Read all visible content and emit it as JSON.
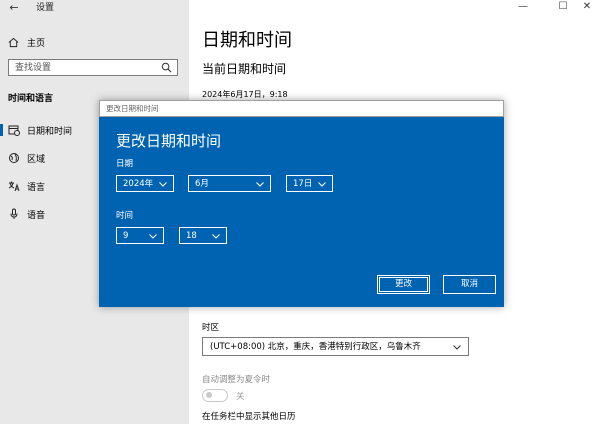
{
  "window": {
    "title": "设置",
    "back_glyph": "←",
    "minimize_glyph": "—",
    "maximize_glyph": "☐",
    "close_glyph": "✕"
  },
  "sidebar": {
    "home_label": "主页",
    "search_placeholder": "查找设置",
    "section_title": "时间和语言",
    "items": [
      {
        "label": "日期和时间",
        "icon": "calendar-clock-icon",
        "active": true
      },
      {
        "label": "区域",
        "icon": "globe-icon",
        "active": false
      },
      {
        "label": "语言",
        "icon": "language-icon",
        "active": false
      },
      {
        "label": "语音",
        "icon": "microphone-icon",
        "active": false
      }
    ]
  },
  "main": {
    "title": "日期和时间",
    "subtitle": "当前日期和时间",
    "current_datetime": "2024年6月17日，9:18",
    "timezone_label": "时区",
    "timezone_value": "(UTC+08:00) 北京，重庆，香港特别行政区，乌鲁木齐",
    "dst_label": "自动调整为夏令时",
    "dst_toggle_state": "关",
    "other_calendar_label": "在任务栏中显示其他日历"
  },
  "dialog": {
    "title": "更改日期和时间",
    "heading": "更改日期和时间",
    "date_label": "日期",
    "year": "2024年",
    "month": "6月",
    "day": "17日",
    "time_label": "时间",
    "hour": "9",
    "minute": "18",
    "change_button": "更改",
    "cancel_button": "取消",
    "accent_color": "#0063b1"
  }
}
